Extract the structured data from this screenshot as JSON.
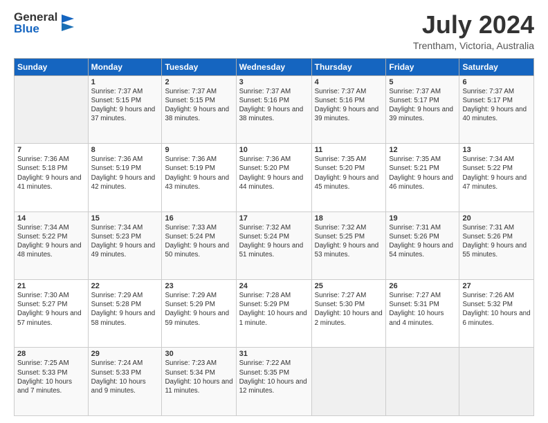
{
  "header": {
    "logo_general": "General",
    "logo_blue": "Blue",
    "month_year": "July 2024",
    "location": "Trentham, Victoria, Australia"
  },
  "calendar": {
    "days_of_week": [
      "Sunday",
      "Monday",
      "Tuesday",
      "Wednesday",
      "Thursday",
      "Friday",
      "Saturday"
    ],
    "weeks": [
      [
        {
          "day": "",
          "info": ""
        },
        {
          "day": "1",
          "info": "Sunrise: 7:37 AM\nSunset: 5:15 PM\nDaylight: 9 hours\nand 37 minutes."
        },
        {
          "day": "2",
          "info": "Sunrise: 7:37 AM\nSunset: 5:15 PM\nDaylight: 9 hours\nand 38 minutes."
        },
        {
          "day": "3",
          "info": "Sunrise: 7:37 AM\nSunset: 5:16 PM\nDaylight: 9 hours\nand 38 minutes."
        },
        {
          "day": "4",
          "info": "Sunrise: 7:37 AM\nSunset: 5:16 PM\nDaylight: 9 hours\nand 39 minutes."
        },
        {
          "day": "5",
          "info": "Sunrise: 7:37 AM\nSunset: 5:17 PM\nDaylight: 9 hours\nand 39 minutes."
        },
        {
          "day": "6",
          "info": "Sunrise: 7:37 AM\nSunset: 5:17 PM\nDaylight: 9 hours\nand 40 minutes."
        }
      ],
      [
        {
          "day": "7",
          "info": "Sunrise: 7:36 AM\nSunset: 5:18 PM\nDaylight: 9 hours\nand 41 minutes."
        },
        {
          "day": "8",
          "info": "Sunrise: 7:36 AM\nSunset: 5:19 PM\nDaylight: 9 hours\nand 42 minutes."
        },
        {
          "day": "9",
          "info": "Sunrise: 7:36 AM\nSunset: 5:19 PM\nDaylight: 9 hours\nand 43 minutes."
        },
        {
          "day": "10",
          "info": "Sunrise: 7:36 AM\nSunset: 5:20 PM\nDaylight: 9 hours\nand 44 minutes."
        },
        {
          "day": "11",
          "info": "Sunrise: 7:35 AM\nSunset: 5:20 PM\nDaylight: 9 hours\nand 45 minutes."
        },
        {
          "day": "12",
          "info": "Sunrise: 7:35 AM\nSunset: 5:21 PM\nDaylight: 9 hours\nand 46 minutes."
        },
        {
          "day": "13",
          "info": "Sunrise: 7:34 AM\nSunset: 5:22 PM\nDaylight: 9 hours\nand 47 minutes."
        }
      ],
      [
        {
          "day": "14",
          "info": "Sunrise: 7:34 AM\nSunset: 5:22 PM\nDaylight: 9 hours\nand 48 minutes."
        },
        {
          "day": "15",
          "info": "Sunrise: 7:34 AM\nSunset: 5:23 PM\nDaylight: 9 hours\nand 49 minutes."
        },
        {
          "day": "16",
          "info": "Sunrise: 7:33 AM\nSunset: 5:24 PM\nDaylight: 9 hours\nand 50 minutes."
        },
        {
          "day": "17",
          "info": "Sunrise: 7:32 AM\nSunset: 5:24 PM\nDaylight: 9 hours\nand 51 minutes."
        },
        {
          "day": "18",
          "info": "Sunrise: 7:32 AM\nSunset: 5:25 PM\nDaylight: 9 hours\nand 53 minutes."
        },
        {
          "day": "19",
          "info": "Sunrise: 7:31 AM\nSunset: 5:26 PM\nDaylight: 9 hours\nand 54 minutes."
        },
        {
          "day": "20",
          "info": "Sunrise: 7:31 AM\nSunset: 5:26 PM\nDaylight: 9 hours\nand 55 minutes."
        }
      ],
      [
        {
          "day": "21",
          "info": "Sunrise: 7:30 AM\nSunset: 5:27 PM\nDaylight: 9 hours\nand 57 minutes."
        },
        {
          "day": "22",
          "info": "Sunrise: 7:29 AM\nSunset: 5:28 PM\nDaylight: 9 hours\nand 58 minutes."
        },
        {
          "day": "23",
          "info": "Sunrise: 7:29 AM\nSunset: 5:29 PM\nDaylight: 9 hours\nand 59 minutes."
        },
        {
          "day": "24",
          "info": "Sunrise: 7:28 AM\nSunset: 5:29 PM\nDaylight: 10 hours\nand 1 minute."
        },
        {
          "day": "25",
          "info": "Sunrise: 7:27 AM\nSunset: 5:30 PM\nDaylight: 10 hours\nand 2 minutes."
        },
        {
          "day": "26",
          "info": "Sunrise: 7:27 AM\nSunset: 5:31 PM\nDaylight: 10 hours\nand 4 minutes."
        },
        {
          "day": "27",
          "info": "Sunrise: 7:26 AM\nSunset: 5:32 PM\nDaylight: 10 hours\nand 6 minutes."
        }
      ],
      [
        {
          "day": "28",
          "info": "Sunrise: 7:25 AM\nSunset: 5:33 PM\nDaylight: 10 hours\nand 7 minutes."
        },
        {
          "day": "29",
          "info": "Sunrise: 7:24 AM\nSunset: 5:33 PM\nDaylight: 10 hours\nand 9 minutes."
        },
        {
          "day": "30",
          "info": "Sunrise: 7:23 AM\nSunset: 5:34 PM\nDaylight: 10 hours\nand 11 minutes."
        },
        {
          "day": "31",
          "info": "Sunrise: 7:22 AM\nSunset: 5:35 PM\nDaylight: 10 hours\nand 12 minutes."
        },
        {
          "day": "",
          "info": ""
        },
        {
          "day": "",
          "info": ""
        },
        {
          "day": "",
          "info": ""
        }
      ]
    ]
  }
}
